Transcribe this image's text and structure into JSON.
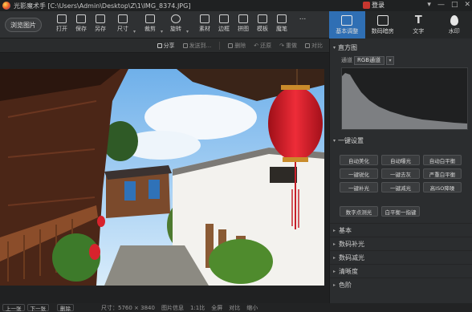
{
  "app": {
    "title": "光影魔术手 [C:\\Users\\Admin\\Desktop\\Z\\1\\IMG_8374.JPG]",
    "login_label": "登录",
    "window_controls": [
      "▾",
      "—",
      "□",
      "✕"
    ]
  },
  "toolbar": {
    "browse_label": "浏览图片",
    "tools": [
      {
        "label": "打开",
        "icon": "folder-icon"
      },
      {
        "label": "保存",
        "icon": "save-icon"
      },
      {
        "label": "另存",
        "icon": "save-as-icon"
      },
      {
        "label": "尺寸",
        "icon": "resize-icon"
      },
      {
        "label": "裁剪",
        "icon": "crop-icon"
      },
      {
        "label": "旋转",
        "icon": "rotate-icon"
      },
      {
        "label": "素材",
        "icon": "material-icon"
      },
      {
        "label": "边框",
        "icon": "border-icon"
      },
      {
        "label": "拼图",
        "icon": "collage-icon"
      },
      {
        "label": "模板",
        "icon": "template-icon"
      },
      {
        "label": "魔笔",
        "icon": "magic-pen-icon"
      },
      {
        "label": "...",
        "icon": "more-icon"
      }
    ]
  },
  "right_tabs": [
    {
      "label": "基本调整",
      "icon": "adjust-icon",
      "active": true
    },
    {
      "label": "数码暗房",
      "icon": "camera-icon",
      "active": false
    },
    {
      "label": "文字",
      "icon": "text-icon",
      "active": false
    },
    {
      "label": "水印",
      "icon": "watermark-icon",
      "active": false
    }
  ],
  "subbar": {
    "items": [
      {
        "label": "分享",
        "enabled": true
      },
      {
        "label": "发送到...",
        "enabled": false
      },
      {
        "label": "删除",
        "enabled": false
      },
      {
        "label": "还原",
        "enabled": false
      },
      {
        "label": "重做",
        "enabled": false
      },
      {
        "label": "对比",
        "enabled": false
      }
    ]
  },
  "panel": {
    "histogram": {
      "title": "直方图",
      "channel_label": "通道",
      "channel_value": "RGB通道"
    },
    "one_click": {
      "title": "一键设置",
      "buttons": [
        "自动美化",
        "自动曝光",
        "自动白平衡",
        "一键锐化",
        "一键去灰",
        "严重白平衡",
        "一键补光",
        "一键减光",
        "高ISO降噪"
      ],
      "extra": [
        "数字点测光",
        "白平衡一指键"
      ]
    },
    "sections": [
      "基本",
      "数码补光",
      "数码减光",
      "清晰度",
      "色阶"
    ]
  },
  "statusbar": {
    "prev_label": "上一张",
    "next_label": "下一张",
    "delete_label": "删除",
    "size_text": "尺寸：5760 × 3840",
    "info_label": "图片信息",
    "ratio_label": "1:1比",
    "fit_label": "全屏",
    "compare_label": "对比",
    "zoom_label": "缩小"
  },
  "colors": {
    "accent": "#2f6fb4",
    "lantern": "#d8232d",
    "sky": "#8cc4f0"
  }
}
